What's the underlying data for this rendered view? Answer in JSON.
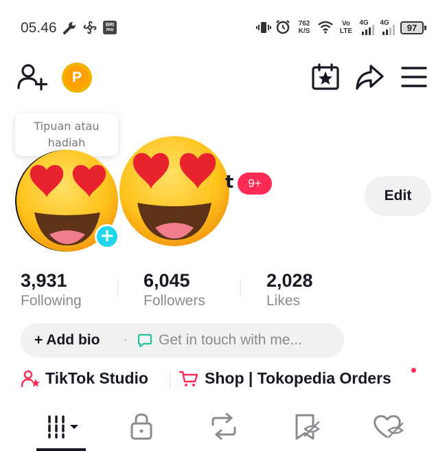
{
  "status_bar": {
    "time": "05.46",
    "net_speed_value": "762",
    "net_speed_unit": "K/S",
    "volte_top": "Vo",
    "volte_bottom": "LTE",
    "sim1_label": "4G",
    "sim2_label": "4G",
    "battery": "97",
    "app_badge": "BRI mo"
  },
  "header": {
    "add_friend_icon": "person-plus-icon",
    "points_letter": "P",
    "calendar_icon": "calendar-star-icon",
    "share_icon": "share-arrow-icon",
    "menu_icon": "hamburger-menu-icon"
  },
  "tooltip": {
    "line1": "Tipuan atau",
    "line2": "hadiah"
  },
  "profile": {
    "username_tail": "t",
    "notification_count": "9+",
    "edit_label": "Edit",
    "add_photo_symbol": "+"
  },
  "stats": [
    {
      "value": "3,931",
      "label": "Following"
    },
    {
      "value": "6,045",
      "label": "Followers"
    },
    {
      "value": "2,028",
      "label": "Likes"
    }
  ],
  "bio": {
    "add_bio_label": "+ Add bio",
    "separator": "·",
    "contact_placeholder": "Get in touch with me..."
  },
  "links": {
    "studio_label": "TikTok Studio",
    "shop_label": "Shop | Tokopedia Orders"
  },
  "tabs": [
    "videos-grid-icon",
    "lock-icon",
    "repost-icon",
    "favorites-icon",
    "liked-icon"
  ],
  "colors": {
    "accent_red": "#fe2c55",
    "text_primary": "#161823",
    "text_secondary": "#8a8b91",
    "pill_bg": "#f1f1f2",
    "points_gold": "#ff9f00",
    "add_photo_blue": "#20d5ec"
  }
}
